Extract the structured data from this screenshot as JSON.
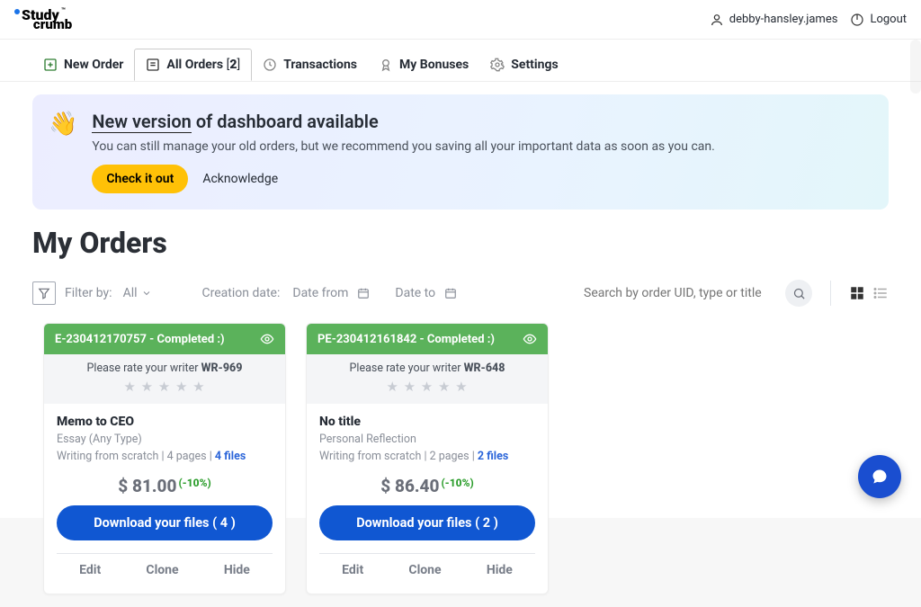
{
  "header": {
    "brand_top": "Study",
    "brand_tm": "™",
    "brand_bottom": "crumb",
    "username": "debby-hansley.james",
    "logout": "Logout"
  },
  "tabs": {
    "new_order": "New Order",
    "all_orders": "All Orders",
    "all_orders_count": "2",
    "transactions": "Transactions",
    "bonuses": "My Bonuses",
    "settings": "Settings"
  },
  "banner": {
    "title_underline": "New version",
    "title_rest": " of dashboard available",
    "body": "You can still manage your old orders, but we recommend you saving all your important data as soon as you can.",
    "check": "Check it out",
    "ack": "Acknowledge"
  },
  "page_title": "My Orders",
  "filters": {
    "filter_by": "Filter by:",
    "all": "All",
    "creation": "Creation date:",
    "date_from": "Date from",
    "date_to": "Date to",
    "search_placeholder": "Search by order UID, type or title"
  },
  "cards": [
    {
      "head": "E-230412170757 - Completed :)",
      "rate_prefix": "Please rate your writer ",
      "writer": "WR-969",
      "title": "Memo to CEO",
      "type": "Essay (Any Type)",
      "detail_pre": "Writing from scratch | 4 pages | ",
      "files_link": "4 files",
      "price": "$ 81.00",
      "discount": "(-10%)",
      "download": "Download your files ( 4 )",
      "a1": "Edit",
      "a2": "Clone",
      "a3": "Hide"
    },
    {
      "head": "PE-230412161842 - Completed :)",
      "rate_prefix": "Please rate your writer ",
      "writer": "WR-648",
      "title": "No title",
      "type": "Personal Reflection",
      "detail_pre": "Writing from scratch | 2 pages | ",
      "files_link": "2 files",
      "price": "$ 86.40",
      "discount": "(-10%)",
      "download": "Download your files ( 2 )",
      "a1": "Edit",
      "a2": "Clone",
      "a3": "Hide"
    }
  ]
}
